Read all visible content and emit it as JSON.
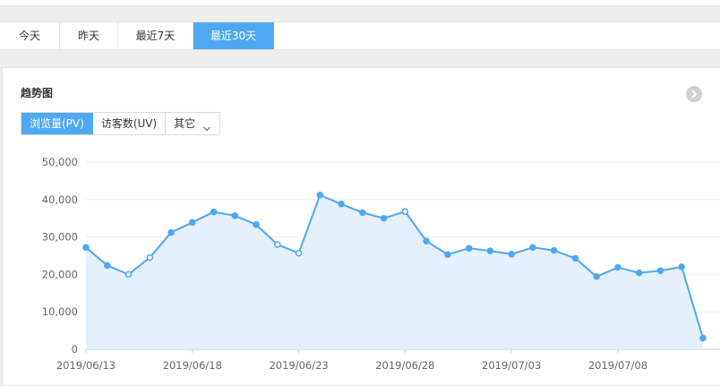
{
  "range_tabs": [
    {
      "label": "今天",
      "active": false
    },
    {
      "label": "昨天",
      "active": false
    },
    {
      "label": "最近7天",
      "active": false
    },
    {
      "label": "最近30天",
      "active": true
    }
  ],
  "panel": {
    "title": "趋势图",
    "more_icon": "chevron-right-circle-icon"
  },
  "metric_tabs": {
    "pv": "浏览量(PV)",
    "uv": "访客数(UV)",
    "other": "其它",
    "active": "pv"
  },
  "colors": {
    "accent": "#4ea8f2",
    "line": "#4ea8f2",
    "area": "#e4f0fb"
  },
  "chart_data": {
    "type": "area",
    "x": [
      "2019/06/13",
      "2019/06/14",
      "2019/06/15",
      "2019/06/16",
      "2019/06/17",
      "2019/06/18",
      "2019/06/19",
      "2019/06/20",
      "2019/06/21",
      "2019/06/22",
      "2019/06/23",
      "2019/06/24",
      "2019/06/25",
      "2019/06/26",
      "2019/06/27",
      "2019/06/28",
      "2019/06/29",
      "2019/06/30",
      "2019/07/01",
      "2019/07/02",
      "2019/07/03",
      "2019/07/04",
      "2019/07/05",
      "2019/07/06",
      "2019/07/07",
      "2019/07/08",
      "2019/07/09",
      "2019/07/10",
      "2019/07/11",
      "2019/07/12"
    ],
    "series": [
      {
        "values": [
          27200,
          22400,
          20000,
          24500,
          31200,
          33900,
          36700,
          35700,
          33300,
          28000,
          25700,
          41200,
          38800,
          36500,
          35000,
          36800,
          28900,
          25300,
          27000,
          26300,
          25400,
          27200,
          26400,
          24300,
          19400,
          21900,
          20400,
          21000,
          22000,
          3000
        ],
        "hollow_points": [
          2,
          3,
          9,
          10,
          15
        ]
      }
    ],
    "xticks": [
      "2019/06/13",
      "2019/06/18",
      "2019/06/23",
      "2019/06/28",
      "2019/07/03",
      "2019/07/08"
    ],
    "yticks": [
      "0",
      "10,000",
      "20,000",
      "30,000",
      "40,000",
      "50,000"
    ],
    "ylim": [
      0,
      50000
    ],
    "grid": true,
    "title": "",
    "xlabel": "",
    "ylabel": ""
  }
}
